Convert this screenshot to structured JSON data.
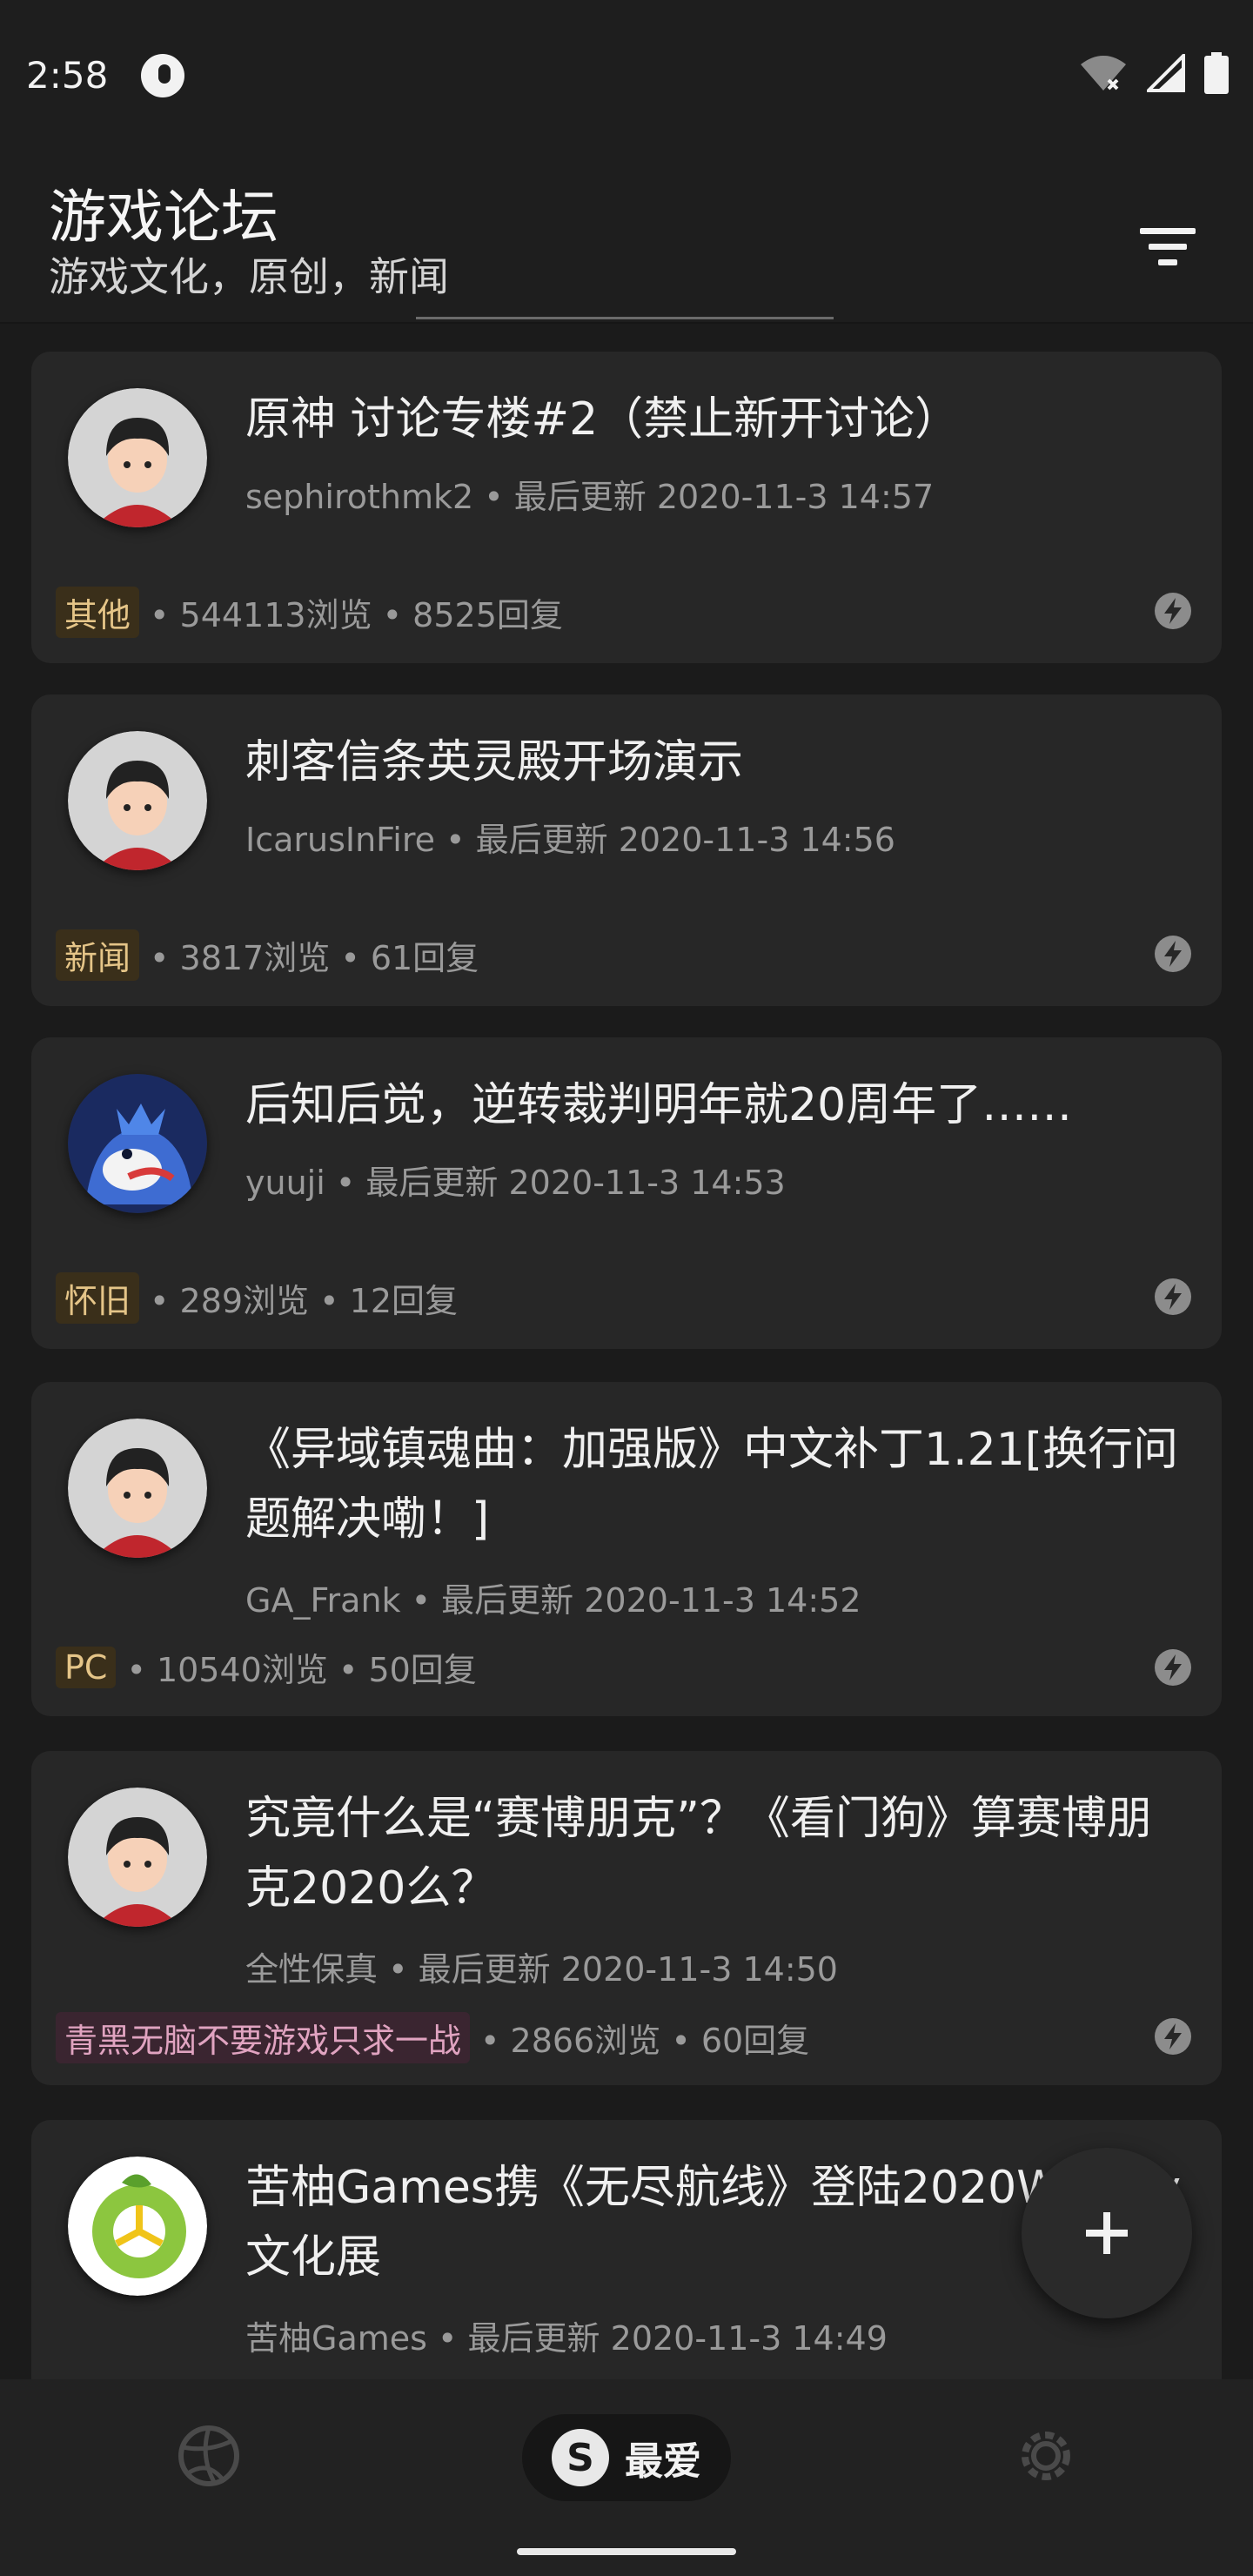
{
  "status_bar": {
    "time": "2:58",
    "app_icon": "app-notification-icon",
    "wifi_icon": "wifi-off-icon",
    "signal_icon": "signal-icon",
    "battery_icon": "battery-icon"
  },
  "header": {
    "title": "游戏论坛",
    "subtitle": "游戏文化，原创，新闻",
    "filter_icon": "filter-icon"
  },
  "posts": [
    {
      "title": "原神 讨论专楼#2（禁止新开讨论）",
      "author": "sephirothmk2",
      "updated_label": "最后更新",
      "updated_at": "2020-11-3 14:57",
      "tag": "其他",
      "views": "544113浏览",
      "replies": "8525回复"
    },
    {
      "title": "刺客信条英灵殿开场演示",
      "author": "IcarusInFire",
      "updated_label": "最后更新",
      "updated_at": "2020-11-3 14:56",
      "tag": "新闻",
      "views": "3817浏览",
      "replies": "61回复"
    },
    {
      "title": "后知后觉，逆转裁判明年就20周年了……",
      "author": "yuuji",
      "updated_label": "最后更新",
      "updated_at": "2020-11-3 14:53",
      "tag": "怀旧",
      "views": "289浏览",
      "replies": "12回复"
    },
    {
      "title": "《异域镇魂曲：加强版》中文补丁1.21[换行问题解决嘞！]",
      "author": "GA_Frank",
      "updated_label": "最后更新",
      "updated_at": "2020-11-3 14:52",
      "tag": "PC",
      "views": "10540浏览",
      "replies": "50回复"
    },
    {
      "title": "究竟什么是“赛博朋克”？《看门狗》算赛博朋克2020么？",
      "author": "全性保真",
      "updated_label": "最后更新",
      "updated_at": "2020-11-3 14:50",
      "tag": "青黑无脑不要游戏只求一战",
      "views": "2866浏览",
      "replies": "60回复"
    },
    {
      "title": "苦柚Games携《无尽航线》登陆2020WePlay文化展",
      "author": "苦柚Games",
      "updated_label": "最后更新",
      "updated_at": "2020-11-3 14:49"
    }
  ],
  "fab": {
    "icon": "plus-icon"
  },
  "bottom_nav": {
    "discover_icon": "volleyball-icon",
    "favorites_badge": "S",
    "favorites_label": "最爱",
    "settings_icon": "gear-icon"
  }
}
